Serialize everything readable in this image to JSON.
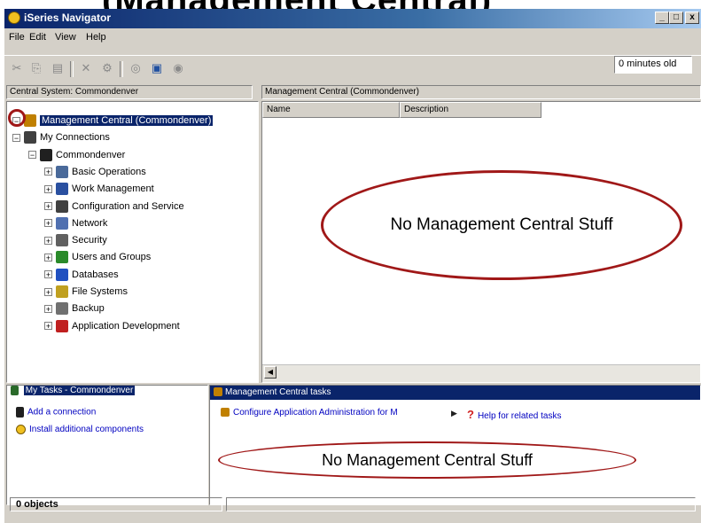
{
  "caption": "(Management Central)",
  "window": {
    "title": "iSeries Navigator",
    "min_label": "_",
    "max_label": "□",
    "close_label": "x"
  },
  "menu": [
    "File",
    "Edit",
    "View",
    "Help"
  ],
  "toolbar": {
    "icons": [
      "cut-icon",
      "copy-icon",
      "paste-icon",
      "delete-icon",
      "properties-icon",
      "new-icon",
      "monitor-icon",
      "status-icon"
    ],
    "glyphs": [
      "✂",
      "⎘",
      "▤",
      "✕",
      "⚙",
      "◎",
      "▣",
      "◉"
    ],
    "age": "0 minutes old"
  },
  "left_header": "Central System: Commondenver",
  "right_header": "Management Central (Commondenver)",
  "tree": [
    {
      "label": "Management Central (Commondenver)",
      "level": 0,
      "expander": "−",
      "selected": true,
      "color": "#c08000"
    },
    {
      "label": "My Connections",
      "level": 0,
      "expander": "−",
      "color": "#404040"
    },
    {
      "label": "Commondenver",
      "level": 1,
      "expander": "−",
      "color": "#202020"
    },
    {
      "label": "Basic Operations",
      "level": 2,
      "expander": "+",
      "color": "#4a6a9a"
    },
    {
      "label": "Work Management",
      "level": 2,
      "expander": "+",
      "color": "#2a50a0"
    },
    {
      "label": "Configuration and Service",
      "level": 2,
      "expander": "+",
      "color": "#404040"
    },
    {
      "label": "Network",
      "level": 2,
      "expander": "+",
      "color": "#5070b0"
    },
    {
      "label": "Security",
      "level": 2,
      "expander": "+",
      "color": "#606060"
    },
    {
      "label": "Users and Groups",
      "level": 2,
      "expander": "+",
      "color": "#2a8a2a"
    },
    {
      "label": "Databases",
      "level": 2,
      "expander": "+",
      "color": "#2050c0"
    },
    {
      "label": "File Systems",
      "level": 2,
      "expander": "+",
      "color": "#c0a020"
    },
    {
      "label": "Backup",
      "level": 2,
      "expander": "+",
      "color": "#707070"
    },
    {
      "label": "Application Development",
      "level": 2,
      "expander": "+",
      "color": "#c02020"
    }
  ],
  "columns": [
    "Name",
    "Description"
  ],
  "annotation_main": "No Management Central Stuff",
  "annotation_bottom": "No Management Central Stuff",
  "tasks_pane": {
    "title": "My Tasks - Commondenver",
    "items": [
      "Add a connection",
      "Install additional components"
    ]
  },
  "mc_tasks": {
    "title": "Management Central tasks",
    "link": "Configure Application Administration for M",
    "help": "Help for related tasks"
  },
  "status": "0 objects",
  "colors": {
    "selection": "#0a246a",
    "annotation": "#a01818",
    "link": "#0000c0"
  }
}
